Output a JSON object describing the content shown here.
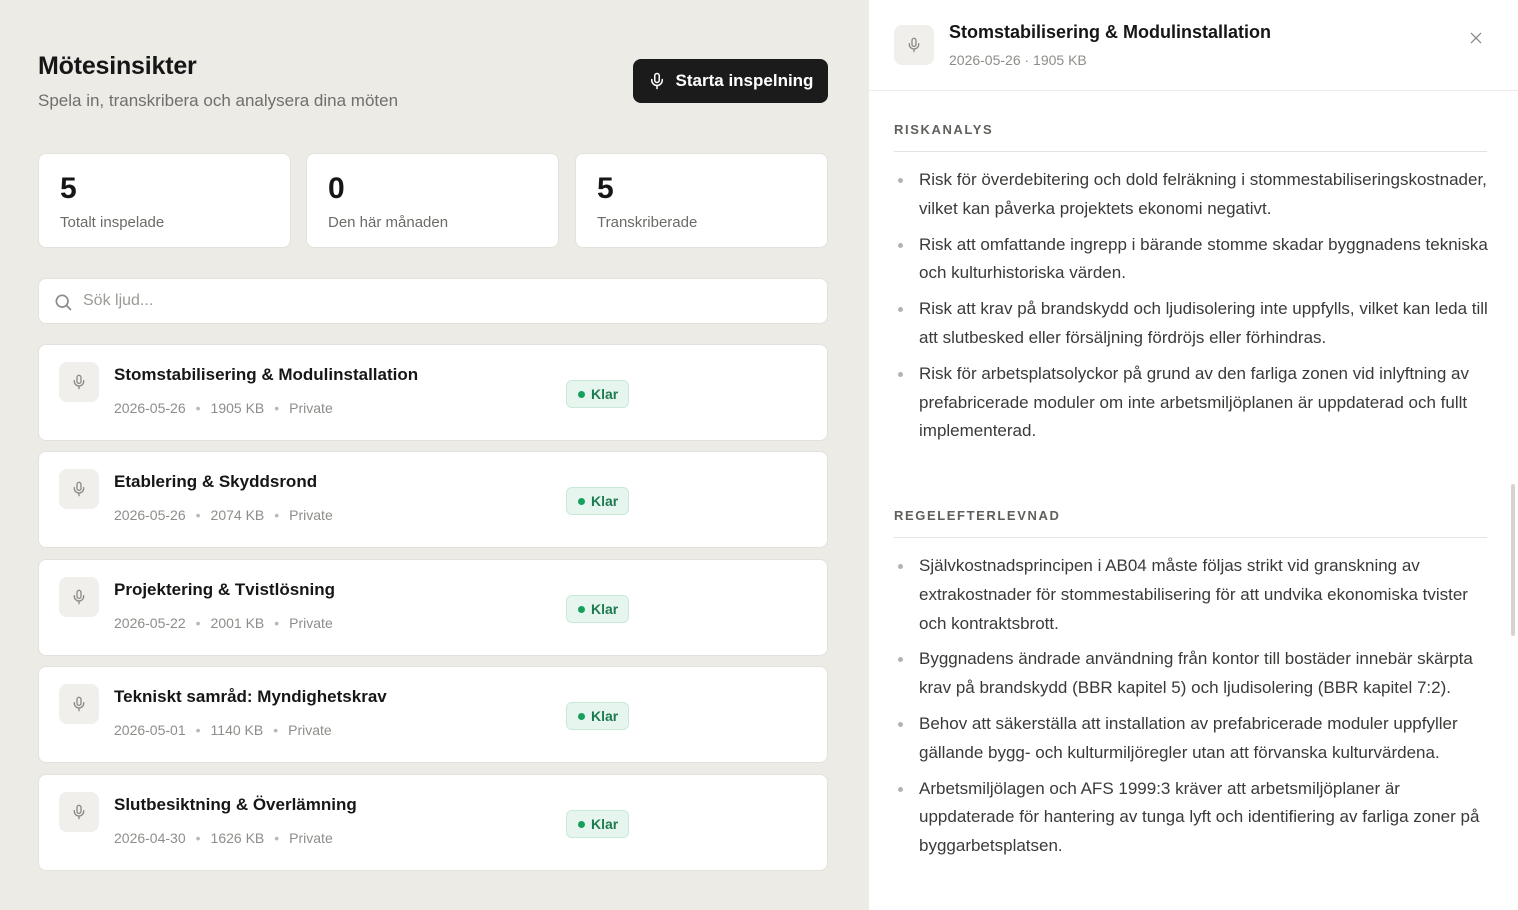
{
  "header": {
    "title": "Mötesinsikter",
    "subtitle": "Spela in, transkribera och analysera dina möten",
    "record_button": "Starta inspelning",
    "record_icon": "microphone-icon"
  },
  "stats": [
    {
      "value": "5",
      "label": "Totalt inspelade"
    },
    {
      "value": "0",
      "label": "Den här månaden"
    },
    {
      "value": "5",
      "label": "Transkriberade"
    }
  ],
  "search": {
    "placeholder": "Sök ljud...",
    "value": "",
    "icon": "search-icon"
  },
  "recordings": [
    {
      "title": "Stomstabilisering & Modulinstallation",
      "date": "2026-05-26",
      "size": "1905 KB",
      "visibility": "Private",
      "status": "Klar"
    },
    {
      "title": "Etablering & Skyddsrond",
      "date": "2026-05-26",
      "size": "2074 KB",
      "visibility": "Private",
      "status": "Klar"
    },
    {
      "title": "Projektering & Tvistlösning",
      "date": "2026-05-22",
      "size": "2001 KB",
      "visibility": "Private",
      "status": "Klar"
    },
    {
      "title": "Tekniskt samråd: Myndighetskrav",
      "date": "2026-05-01",
      "size": "1140 KB",
      "visibility": "Private",
      "status": "Klar"
    },
    {
      "title": "Slutbesiktning & Överlämning",
      "date": "2026-04-30",
      "size": "1626 KB",
      "visibility": "Private",
      "status": "Klar"
    }
  ],
  "detail": {
    "title": "Stomstabilisering & Modulinstallation",
    "meta": "2026-05-26 · 1905 KB",
    "sections": [
      {
        "heading": "RISKANALYS",
        "items": [
          "Risk för överdebitering och dold felräkning i stommestabiliseringskostnader, vilket kan påverka projektets ekonomi negativt.",
          "Risk att omfattande ingrepp i bärande stomme skadar byggnadens tekniska och kulturhistoriska värden.",
          "Risk att krav på brandskydd och ljudisolering inte uppfylls, vilket kan leda till att slutbesked eller försäljning fördröjs eller förhindras.",
          "Risk för arbetsplatsolyckor på grund av den farliga zonen vid inlyftning av prefabricerade moduler om inte arbetsmiljöplanen är uppdaterad och fullt implementerad."
        ]
      },
      {
        "heading": "REGELEFTERLEVNAD",
        "items": [
          "Självkostnadsprincipen i AB04 måste följas strikt vid granskning av extrakostnader för stommestabilisering för att undvika ekonomiska tvister och kontraktsbrott.",
          "Byggnadens ändrade användning från kontor till bostäder innebär skärpta krav på brandskydd (BBR kapitel 5) och ljudisolering (BBR kapitel 7:2).",
          "Behov att säkerställa att installation av prefabricerade moduler uppfyller gällande bygg- och kulturmiljöregler utan att förvanska kulturvärdena.",
          "Arbetsmiljölagen och AFS 1999:3 kräver att arbetsmiljöplaner är uppdaterade för hantering av tunga lyft och identifiering av farliga zoner på byggarbetsplatsen."
        ]
      }
    ]
  },
  "colors": {
    "accent": "#1b1b1b",
    "status_green": "#16a05c",
    "background": "#edebe6"
  }
}
